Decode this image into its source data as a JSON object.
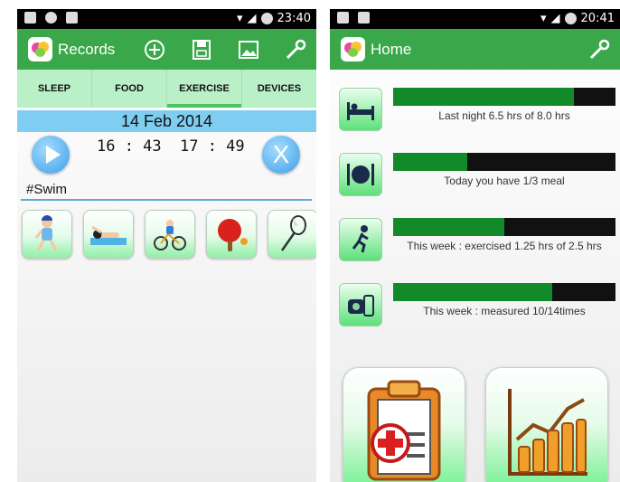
{
  "phone1": {
    "status_time": "23:40",
    "app_title": "Records",
    "actions": [
      "add-icon",
      "save-icon",
      "image-icon",
      "wrench-icon"
    ],
    "tabs": [
      {
        "label": "SLEEP",
        "active": false
      },
      {
        "label": "FOOD",
        "active": false
      },
      {
        "label": "EXERCISE",
        "active": true
      },
      {
        "label": "DEVICES",
        "active": false
      }
    ],
    "date": "14 Feb 2014",
    "time_start": "16 : 43",
    "time_end": "17 : 49",
    "close_label": "X",
    "activity_value": "#Swim",
    "activities": [
      "running",
      "swimming",
      "cycling",
      "table-tennis",
      "badminton"
    ]
  },
  "phone2": {
    "status_time": "20:41",
    "app_title": "Home",
    "stats": [
      {
        "name": "sleep",
        "text": "Last night 6.5 hrs of 8.0 hrs",
        "fill": 0.8125
      },
      {
        "name": "food",
        "text": "Today you have  1/3 meal",
        "fill": 0.333
      },
      {
        "name": "exercise",
        "text": "This week : exercised 1.25 hrs of 2.5 hrs",
        "fill": 0.5
      },
      {
        "name": "devices",
        "text": "This week : measured 10/14times",
        "fill": 0.714
      }
    ]
  },
  "colors": {
    "appbar": "#3aa84a",
    "tabs_bg": "#b9f0c8",
    "date_bar": "#7fcdf0",
    "progress_fill": "#138a2a"
  }
}
